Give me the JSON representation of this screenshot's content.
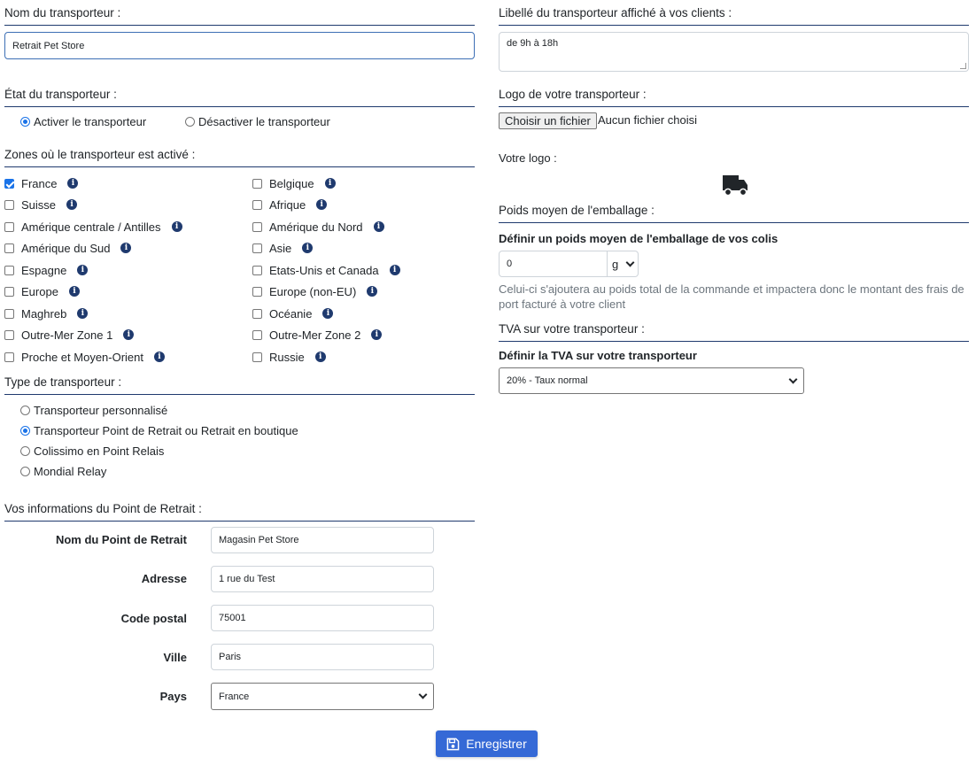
{
  "carrier_name": {
    "label": "Nom du transporteur :",
    "value": "Retrait Pet Store"
  },
  "carrier_label": {
    "label": "Libellé du transporteur affiché à vos clients :",
    "value": "de 9h à 18h"
  },
  "carrier_state": {
    "label": "État du transporteur :",
    "options": [
      {
        "label": "Activer le transporteur",
        "checked": true
      },
      {
        "label": "Désactiver le transporteur",
        "checked": false
      }
    ]
  },
  "logo": {
    "label": "Logo de votre transporteur :",
    "choose_button": "Choisir un fichier",
    "no_file": "Aucun fichier choisi",
    "your_logo_label": "Votre logo :",
    "icon": "truck-icon"
  },
  "zones": {
    "label": "Zones où le transporteur est activé :",
    "left": [
      {
        "label": "France",
        "checked": true
      },
      {
        "label": "Suisse",
        "checked": false
      },
      {
        "label": "Amérique centrale / Antilles",
        "checked": false
      },
      {
        "label": "Amérique du Sud",
        "checked": false
      },
      {
        "label": "Espagne",
        "checked": false
      },
      {
        "label": "Europe",
        "checked": false
      },
      {
        "label": "Maghreb",
        "checked": false
      },
      {
        "label": "Outre-Mer Zone 1",
        "checked": false
      },
      {
        "label": "Proche et Moyen-Orient",
        "checked": false
      }
    ],
    "right": [
      {
        "label": "Belgique",
        "checked": false
      },
      {
        "label": "Afrique",
        "checked": false
      },
      {
        "label": "Amérique du Nord",
        "checked": false
      },
      {
        "label": "Asie",
        "checked": false
      },
      {
        "label": "Etats-Unis et Canada",
        "checked": false
      },
      {
        "label": "Europe (non-EU)",
        "checked": false
      },
      {
        "label": "Océanie",
        "checked": false
      },
      {
        "label": "Outre-Mer Zone 2",
        "checked": false
      },
      {
        "label": "Russie",
        "checked": false
      }
    ]
  },
  "packaging": {
    "label": "Poids moyen de l'emballage :",
    "sublabel": "Définir un poids moyen de l'emballage de vos colis",
    "value": "0",
    "unit": "g",
    "help": "Celui-ci s'ajoutera au poids total de la commande et impactera donc le montant des frais de port facturé à votre client"
  },
  "vat": {
    "label": "TVA sur votre transporteur :",
    "sublabel": "Définir la TVA sur votre transporteur",
    "selected": "20% - Taux normal"
  },
  "carrier_type": {
    "label": "Type de transporteur :",
    "options": [
      {
        "label": "Transporteur personnalisé",
        "checked": false
      },
      {
        "label": "Transporteur Point de Retrait ou Retrait en boutique",
        "checked": true
      },
      {
        "label": "Colissimo en Point Relais",
        "checked": false
      },
      {
        "label": "Mondial Relay",
        "checked": false
      }
    ]
  },
  "pickup": {
    "label": "Vos informations du Point de Retrait :",
    "name_label": "Nom du Point de Retrait",
    "name_value": "Magasin Pet Store",
    "address_label": "Adresse",
    "address_value": "1 rue du Test",
    "zip_label": "Code postal",
    "zip_value": "75001",
    "city_label": "Ville",
    "city_value": "Paris",
    "country_label": "Pays",
    "country_value": "France"
  },
  "save_button": {
    "label": "Enregistrer",
    "icon": "floppy-disk-icon"
  },
  "colors": {
    "accent": "#1f3a6e",
    "button": "#3569d6",
    "radio": "#1a73e8"
  }
}
